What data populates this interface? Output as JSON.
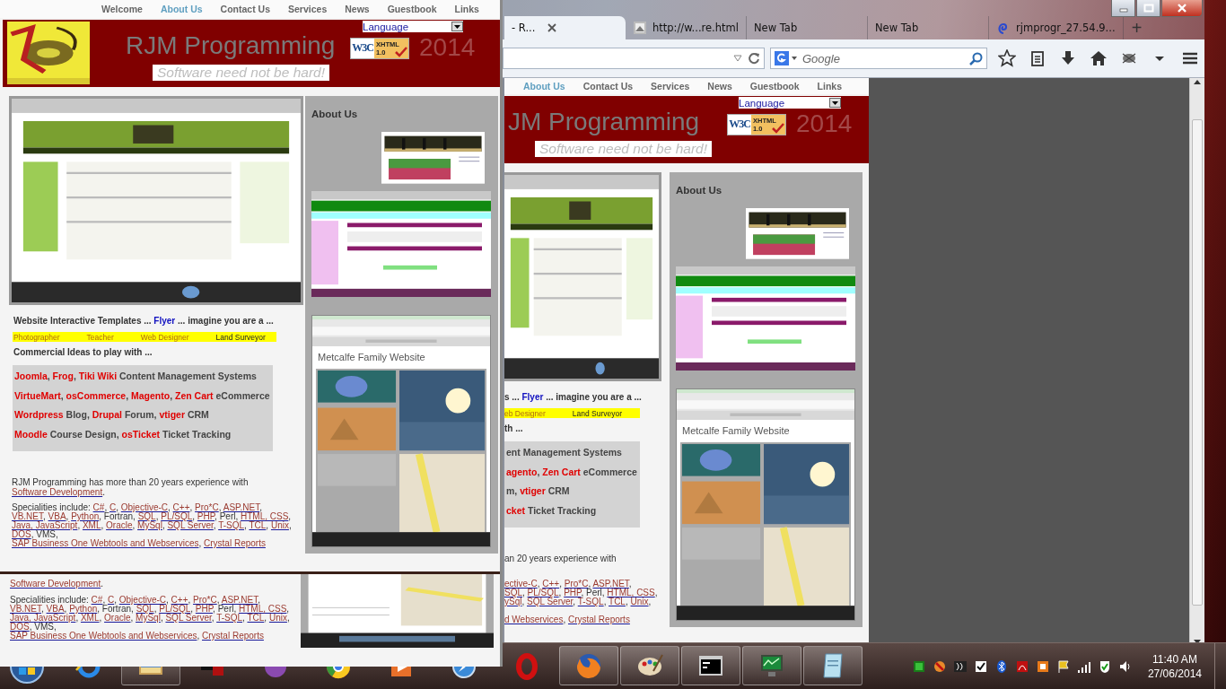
{
  "browser": {
    "tabs": [
      {
        "label": "- R...",
        "selected": true
      },
      {
        "label": "http://w...re.html",
        "selected": false
      },
      {
        "label": "New Tab",
        "selected": false
      },
      {
        "label": "New Tab",
        "selected": false
      },
      {
        "label": "rjmprogr_27.54.9...",
        "selected": false
      }
    ],
    "new_tab": "+",
    "search": {
      "placeholder": "Google"
    },
    "page": {
      "nav": [
        {
          "label": "About Us",
          "selected": true
        },
        {
          "label": "Contact Us",
          "selected": false
        },
        {
          "label": "Services",
          "selected": false
        },
        {
          "label": "News",
          "selected": false
        },
        {
          "label": "Guestbook",
          "selected": false
        },
        {
          "label": "Links",
          "selected": false
        }
      ],
      "header": {
        "language": "Language",
        "title": "JM Programming",
        "tagline": "Software need not be hard!",
        "badge": {
          "mark": "W3C",
          "label": "XHTML",
          "version": "1.0"
        },
        "year": "2014"
      },
      "templates_line": [
        "s ... ",
        {
          "t": "Flyer",
          "kind": "blue"
        },
        " ... imagine you are a ..."
      ],
      "roles": [
        {
          "label": "eb Designer",
          "visited": true
        },
        {
          "label": "Land Surveyor",
          "visited": false
        }
      ],
      "ideas_heading": "th ...",
      "ideas": [
        [
          "ent Management Systems"
        ],
        [
          {
            "t": "agento",
            "kind": "red"
          },
          ", ",
          {
            "t": "Zen Cart",
            "kind": "red"
          },
          " eCommerce"
        ],
        [
          "m, ",
          {
            "t": "vtiger",
            "kind": "red"
          },
          " CRM"
        ],
        [
          {
            "t": "cket",
            "kind": "red"
          },
          " Ticket Tracking"
        ]
      ],
      "experience": [
        [
          "an 20 years experience with"
        ]
      ],
      "specialities": [
        [
          {
            "t": "ective-C",
            "kind": "link"
          },
          ", ",
          {
            "t": "C++",
            "kind": "link"
          },
          ", ",
          {
            "t": "Pro*C",
            "kind": "link"
          },
          ", ",
          {
            "t": "ASP.NET",
            "kind": "link"
          },
          ","
        ],
        [
          {
            "t": "SQL",
            "kind": "link"
          },
          ", ",
          {
            "t": "PL/SQL",
            "kind": "link"
          },
          ", ",
          {
            "t": "PHP",
            "kind": "link"
          },
          ", Perl, ",
          {
            "t": "HTML, CSS",
            "kind": "link"
          },
          ","
        ],
        [
          {
            "t": "ySql",
            "kind": "link"
          },
          ", ",
          {
            "t": "SQL Server",
            "kind": "link"
          },
          ", ",
          {
            "t": "T-SQL",
            "kind": "link"
          },
          ", ",
          {
            "t": "TCL",
            "kind": "link"
          },
          ", ",
          {
            "t": "Unix",
            "kind": "link"
          },
          ","
        ]
      ],
      "specialities_end": [
        [
          {
            "t": "d Webservices",
            "kind": "link"
          },
          ", ",
          {
            "t": "Crystal Reports",
            "kind": "link"
          }
        ]
      ],
      "about": {
        "heading": "About Us",
        "shot_title": "Metcalfe Family Website"
      }
    }
  },
  "popup": {
    "nav": [
      {
        "label": "Welcome",
        "selected": false
      },
      {
        "label": "About Us",
        "selected": true
      },
      {
        "label": "Contact Us",
        "selected": false
      },
      {
        "label": "Services",
        "selected": false
      },
      {
        "label": "News",
        "selected": false
      },
      {
        "label": "Guestbook",
        "selected": false
      },
      {
        "label": "Links",
        "selected": false
      }
    ],
    "header": {
      "language": "Language",
      "title": "RJM Programming",
      "tagline": "Software need not be hard!",
      "badge": {
        "mark": "W3C",
        "label": "XHTML",
        "version": "1.0"
      },
      "year": "2014"
    },
    "templates_line": [
      "Website Interactive Templates ... ",
      {
        "t": "Flyer",
        "kind": "blue"
      },
      " ... imagine you are a ..."
    ],
    "roles": [
      {
        "label": "Photographer",
        "visited": true
      },
      {
        "label": "Teacher",
        "visited": true
      },
      {
        "label": "Web Designer",
        "visited": true
      },
      {
        "label": "Land Surveyor",
        "visited": false
      }
    ],
    "ideas_heading": "Commercial Ideas to play with ...",
    "ideas": [
      [
        {
          "t": "Joomla",
          "kind": "red"
        },
        ", ",
        {
          "t": "Frog",
          "kind": "red"
        },
        ", ",
        {
          "t": "Tiki Wiki",
          "kind": "red"
        },
        " Content Management Systems"
      ],
      [
        {
          "t": "VirtueMart",
          "kind": "red"
        },
        ", ",
        {
          "t": "osCommerce",
          "kind": "red"
        },
        ", ",
        {
          "t": "Magento",
          "kind": "red"
        },
        ", ",
        {
          "t": "Zen Cart",
          "kind": "red"
        },
        " eCommerce"
      ],
      [
        {
          "t": "Wordpress",
          "kind": "red"
        },
        " Blog, ",
        {
          "t": "Drupal",
          "kind": "red"
        },
        " Forum, ",
        {
          "t": "vtiger",
          "kind": "red"
        },
        " CRM"
      ],
      [
        {
          "t": "Moodle",
          "kind": "red"
        },
        " Course Design, ",
        {
          "t": "osTicket",
          "kind": "red"
        },
        " Ticket Tracking"
      ]
    ],
    "experience": [
      [
        "RJM Programming has more than 20 years experience with"
      ],
      [
        {
          "t": "Software Development",
          "kind": "link"
        },
        "."
      ]
    ],
    "specialities": [
      [
        "Specialities include: ",
        {
          "t": "C#",
          "kind": "link"
        },
        ", ",
        {
          "t": "C",
          "kind": "link"
        },
        ", ",
        {
          "t": "Objective-C",
          "kind": "link"
        },
        ", ",
        {
          "t": "C++",
          "kind": "link"
        },
        ", ",
        {
          "t": "Pro*C",
          "kind": "link"
        },
        ", ",
        {
          "t": "ASP.NET",
          "kind": "link"
        },
        ","
      ],
      [
        {
          "t": "VB.NET",
          "kind": "link"
        },
        ", ",
        {
          "t": "VBA",
          "kind": "link"
        },
        ", ",
        {
          "t": "Python",
          "kind": "link"
        },
        ", Fortran, ",
        {
          "t": "SQL",
          "kind": "link"
        },
        ", ",
        {
          "t": "PL/SQL",
          "kind": "link"
        },
        ", ",
        {
          "t": "PHP",
          "kind": "link"
        },
        ", Perl, ",
        {
          "t": "HTML, CSS",
          "kind": "link"
        },
        ","
      ],
      [
        {
          "t": "Java, JavaScript",
          "kind": "link"
        },
        ", ",
        {
          "t": "XML",
          "kind": "link"
        },
        ", ",
        {
          "t": "Oracle",
          "kind": "link"
        },
        ", ",
        {
          "t": "MySql",
          "kind": "link"
        },
        ", ",
        {
          "t": "SQL Server",
          "kind": "link"
        },
        ", ",
        {
          "t": "T-SQL",
          "kind": "link"
        },
        ", ",
        {
          "t": "TCL",
          "kind": "link"
        },
        ", ",
        {
          "t": "Unix",
          "kind": "link"
        },
        ","
      ],
      [
        {
          "t": "DOS",
          "kind": "link"
        },
        ", VMS,"
      ],
      [
        {
          "t": "SAP Business One Webtools and Webservices",
          "kind": "link"
        },
        ", ",
        {
          "t": "Crystal Reports",
          "kind": "link"
        }
      ]
    ],
    "about": {
      "heading": "About Us",
      "shot_title": "Metcalfe Family Website"
    },
    "lower": {
      "experience": [
        [
          {
            "t": "Software Development",
            "kind": "link"
          },
          "."
        ]
      ],
      "specialities": [
        [
          "Specialities include: ",
          {
            "t": "C#",
            "kind": "link"
          },
          ", ",
          {
            "t": "C",
            "kind": "link"
          },
          ", ",
          {
            "t": "Objective-C",
            "kind": "link"
          },
          ", ",
          {
            "t": "C++",
            "kind": "link"
          },
          ", ",
          {
            "t": "Pro*C",
            "kind": "link"
          },
          ", ",
          {
            "t": "ASP.NET",
            "kind": "link"
          },
          ","
        ],
        [
          {
            "t": "VB.NET",
            "kind": "link"
          },
          ", ",
          {
            "t": "VBA",
            "kind": "link"
          },
          ", ",
          {
            "t": "Python",
            "kind": "link"
          },
          ", Fortran, ",
          {
            "t": "SQL",
            "kind": "link"
          },
          ", ",
          {
            "t": "PL/SQL",
            "kind": "link"
          },
          ", ",
          {
            "t": "PHP",
            "kind": "link"
          },
          ", Perl, ",
          {
            "t": "HTML, CSS",
            "kind": "link"
          },
          ","
        ],
        [
          {
            "t": "Java, JavaScript",
            "kind": "link"
          },
          ", ",
          {
            "t": "XML",
            "kind": "link"
          },
          ", ",
          {
            "t": "Oracle",
            "kind": "link"
          },
          ", ",
          {
            "t": "MySql",
            "kind": "link"
          },
          ", ",
          {
            "t": "SQL Server",
            "kind": "link"
          },
          ", ",
          {
            "t": "T-SQL",
            "kind": "link"
          },
          ", ",
          {
            "t": "TCL",
            "kind": "link"
          },
          ", ",
          {
            "t": "Unix",
            "kind": "link"
          },
          ","
        ],
        [
          {
            "t": "DOS",
            "kind": "link"
          },
          ", VMS,"
        ],
        [
          {
            "t": "SAP Business One Webtools and Webservices",
            "kind": "link"
          },
          ", ",
          {
            "t": "Crystal Reports",
            "kind": "link"
          }
        ]
      ]
    }
  },
  "taskbar": {
    "apps": [
      {
        "kind": "e-ring",
        "running": false
      },
      {
        "kind": "folder",
        "running": true
      },
      {
        "kind": "squares",
        "running": false
      },
      {
        "kind": "orb",
        "running": false
      },
      {
        "kind": "wheel",
        "running": false
      },
      {
        "kind": "play",
        "running": false
      },
      {
        "kind": "compass",
        "running": false
      },
      {
        "kind": "ring-red",
        "running": false
      },
      {
        "kind": "globe",
        "running": true
      },
      {
        "kind": "palette",
        "running": true
      },
      {
        "kind": "terminal",
        "running": true
      },
      {
        "kind": "monitor",
        "running": true
      },
      {
        "kind": "notepad",
        "running": true
      }
    ],
    "clock": {
      "time": "11:40 AM",
      "date": "27/06/2014"
    }
  }
}
